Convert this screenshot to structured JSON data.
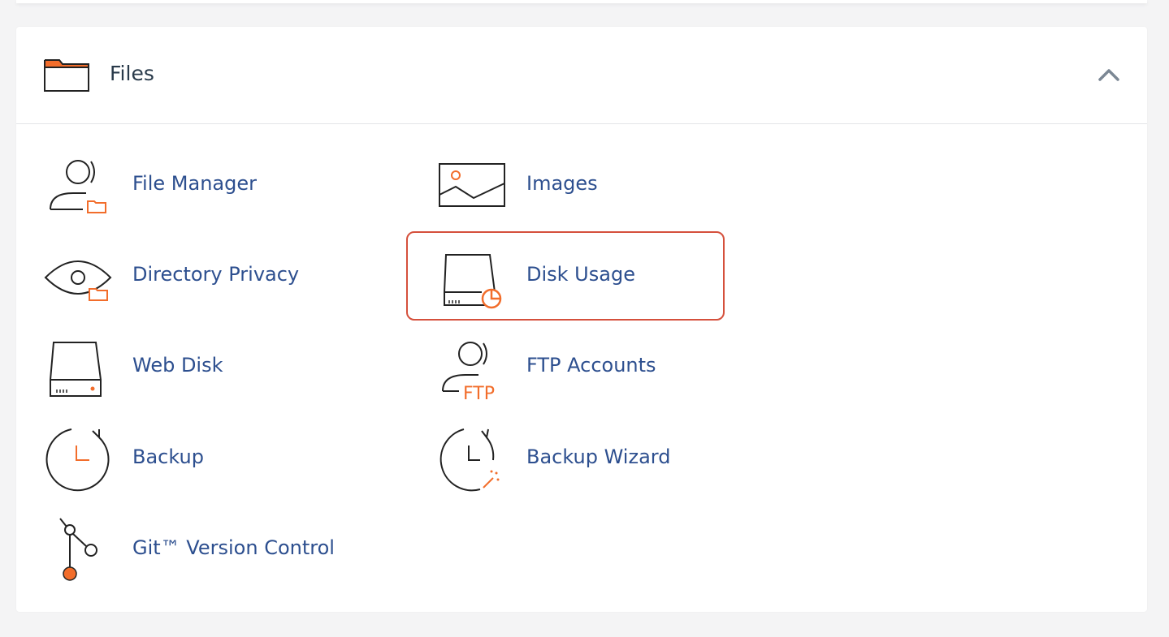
{
  "section": {
    "title": "Files",
    "collapse_icon": "chevron-up-icon"
  },
  "items": [
    {
      "label": "File Manager",
      "icon": "file-manager-icon"
    },
    {
      "label": "Images",
      "icon": "images-icon"
    },
    {
      "label": "Directory Privacy",
      "icon": "directory-privacy-icon"
    },
    {
      "label": "Disk Usage",
      "icon": "disk-usage-icon",
      "highlighted": true
    },
    {
      "label": "Web Disk",
      "icon": "web-disk-icon"
    },
    {
      "label": "FTP Accounts",
      "icon": "ftp-accounts-icon"
    },
    {
      "label": "Backup",
      "icon": "backup-icon"
    },
    {
      "label": "Backup Wizard",
      "icon": "backup-wizard-icon"
    },
    {
      "label": "Git™ Version Control",
      "icon": "git-version-control-icon"
    }
  ],
  "ftp_icon_text": "FTP",
  "colors": {
    "link": "#2d4f8f",
    "accent": "#f26d2b",
    "highlight_border": "#d5503c",
    "icon_stroke": "#222222"
  }
}
